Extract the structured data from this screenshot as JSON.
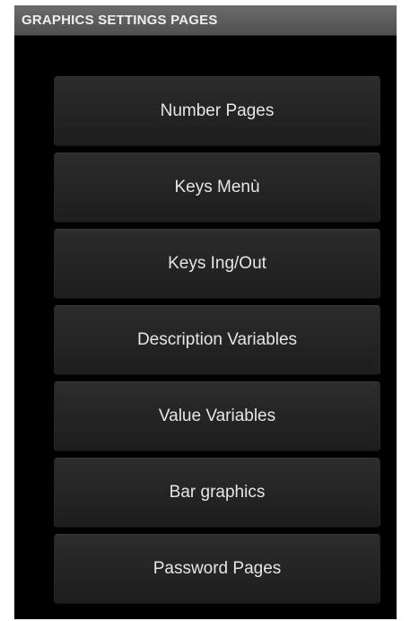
{
  "title_bar": {
    "title": "GRAPHICS SETTINGS PAGES"
  },
  "menu": {
    "items": [
      {
        "label": "Number Pages"
      },
      {
        "label": "Keys Menù"
      },
      {
        "label": "Keys Ing/Out"
      },
      {
        "label": "Description Variables"
      },
      {
        "label": "Value Variables"
      },
      {
        "label": "Bar graphics"
      },
      {
        "label": "Password Pages"
      }
    ]
  },
  "colors": {
    "background": "#000000",
    "title_bar": "#5c5c5c",
    "button": "#252525",
    "text": "#e6e6e6"
  }
}
